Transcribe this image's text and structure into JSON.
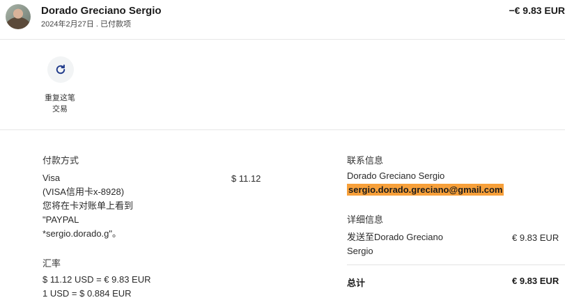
{
  "header": {
    "name": "Dorado Greciano Sergio",
    "subtitle": "2024年2月27日 . 已付款项",
    "amount": "−€ 9.83 EUR"
  },
  "actions": {
    "repeat_label_line1": "重复这笔",
    "repeat_label_line2": "交易"
  },
  "payment": {
    "title": "付款方式",
    "lines": [
      "Visa",
      "(VISA信用卡x-8928)",
      "您将在卡对账单上看到",
      "\"PAYPAL",
      "*sergio.dorado.g\"。"
    ],
    "amount": "$ 11.12"
  },
  "exchange": {
    "title": "汇率",
    "line1": "$ 11.12 USD = € 9.83 EUR",
    "line2": "1 USD = $ 0.884 EUR"
  },
  "contact": {
    "title": "联系信息",
    "name": "Dorado Greciano Sergio",
    "email": "sergio.dorado.greciano@gmail.com"
  },
  "details": {
    "title": "详细信息",
    "ship_label_line1": "发送至Dorado Greciano",
    "ship_label_line2": "Sergio",
    "ship_amount": "€ 9.83 EUR",
    "total_label": "总计",
    "total_amount": "€ 9.83 EUR"
  },
  "colors": {
    "highlight": "#f7a03a",
    "icon": "#1f3a8a"
  }
}
